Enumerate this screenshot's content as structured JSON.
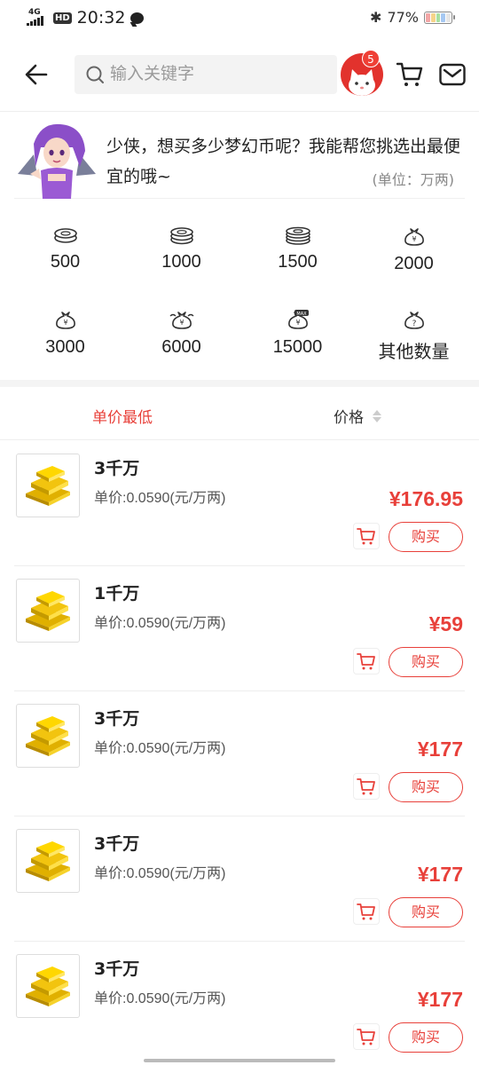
{
  "status_bar": {
    "network": "4G",
    "hd": "HD",
    "time": "20:32",
    "battery_percent": "77%",
    "battery_level": 0.77
  },
  "header": {
    "search_placeholder": "输入关键字",
    "notification_count": "5"
  },
  "banner": {
    "message": "少侠，想买多少梦幻币呢？我能帮您挑选出最便宜的哦~",
    "unit_note": "(单位：万两)"
  },
  "amounts": [
    {
      "label": "500",
      "icon": "coin-stack-small-icon"
    },
    {
      "label": "1000",
      "icon": "coin-stack-medium-icon"
    },
    {
      "label": "1500",
      "icon": "coin-stack-large-icon"
    },
    {
      "label": "2000",
      "icon": "money-bag-icon"
    },
    {
      "label": "3000",
      "icon": "money-bag-icon"
    },
    {
      "label": "6000",
      "icon": "money-bag-double-icon"
    },
    {
      "label": "15000",
      "icon": "money-bag-max-icon"
    },
    {
      "label": "其他数量",
      "icon": "money-bag-question-icon"
    }
  ],
  "sort": {
    "lowest_unit_price": "单价最低",
    "price": "价格"
  },
  "listings": [
    {
      "title": "3千万",
      "unit_price": "单价:0.0590(元/万两)",
      "price": "¥176.95",
      "buy": "购买"
    },
    {
      "title": "1千万",
      "unit_price": "单价:0.0590(元/万两)",
      "price": "¥59",
      "buy": "购买"
    },
    {
      "title": "3千万",
      "unit_price": "单价:0.0590(元/万两)",
      "price": "¥177",
      "buy": "购买"
    },
    {
      "title": "3千万",
      "unit_price": "单价:0.0590(元/万两)",
      "price": "¥177",
      "buy": "购买"
    },
    {
      "title": "3千万",
      "unit_price": "单价:0.0590(元/万两)",
      "price": "¥177",
      "buy": "购买"
    }
  ],
  "colors": {
    "accent": "#e8403a",
    "avatar_bg": "#e2322d",
    "gold": "#f2c40f"
  }
}
